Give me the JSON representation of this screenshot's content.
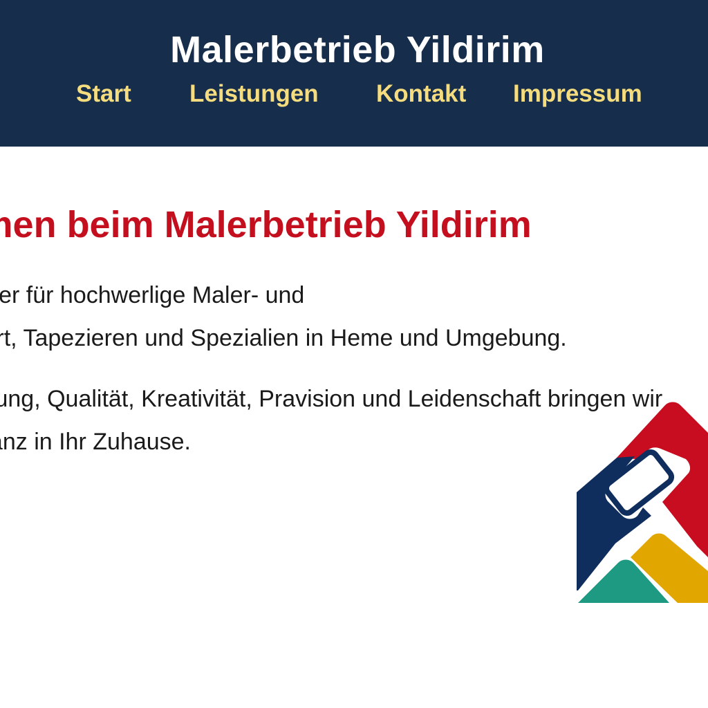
{
  "header": {
    "site_title": "Malerbetrieb Yildirim",
    "nav": [
      {
        "label": "Start"
      },
      {
        "label": "Leistungen"
      },
      {
        "label": "Kontakt"
      },
      {
        "label": "Impressum"
      }
    ]
  },
  "main": {
    "heading": "Willkommen beim Malerbetrieb Yildirim",
    "paragraphs": [
      {
        "line1": "Ihr zuverlässiger Partner für hochwerlige Maler- und",
        "line2": "Lackierarbeiten aller Art, Tapezieren und Spezialien in Heme und Umgebung."
      },
      {
        "line1": "Mit langjähriger Erfahrung, Qualität, Kreativität, Pravision und Leidenschaft bringen wir",
        "line2": "Farbe und frischen Glanz in Ihr Zuhause."
      }
    ]
  },
  "logo": {
    "icon": "paint-roller-house-icon",
    "colors": {
      "red": "#c70d1f",
      "navy": "#0f2e5e",
      "yellow": "#e2a600",
      "teal": "#1f9a82"
    }
  },
  "colors": {
    "header_bg": "#162d4b",
    "nav_text": "#f5dc7e",
    "heading": "#c40f1e",
    "body_text": "#1a1a1a"
  }
}
